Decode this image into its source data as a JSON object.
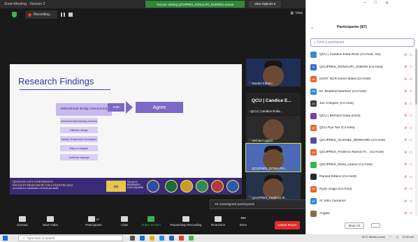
{
  "window": {
    "app_title": "Zoom Meeting - Session 2",
    "share_banner": "You are viewing QCUPRES_DONALPH_DUERN's screen",
    "view_options": "View Options ▾",
    "recording": "Recording...",
    "view": "View"
  },
  "slide": {
    "title": "Research Findings",
    "instructional_box": "Instructional design (resources)",
    "mean_value": "3.50",
    "result": "Agree",
    "sub_items": [
      "Interactive/self-learning modules",
      "Effective design",
      "Variety of instruction techniques",
      "Easy to navigate",
      "Audit/use displays"
    ],
    "footer_line1": "QUEZON CITY UNIVERSITY",
    "footer_line2": "FACULTY RESEARCH COLLOQUIUM 2022",
    "footer_line3": "AN ANNUAL GATHERING OF RESEARCHERS",
    "footer_mid": "4th",
    "footer_mid2": "FACULTY RESEARCH COLLOQUIUM"
  },
  "video_tiles": [
    {
      "name": "Randol Edtaco"
    },
    {
      "name": "QCU | Candice E..."
    },
    {
      "name": "Michael Ligayo"
    },
    {
      "name": "QCUPRES_DONALPH..."
    },
    {
      "name": "QCUPRES_Federico R..."
    }
  ],
  "text_tile": {
    "big": "QCU | Candice E...",
    "small": "QCU | Candice Erika..."
  },
  "toast": "19 unassigned participants",
  "toolbar": {
    "unmute": "Unmute",
    "start_video": "Start Video",
    "participants": "Participants",
    "participants_count": "87",
    "chat": "Chat",
    "share_screen": "Share Screen",
    "pause_recording": "Pause/Stop Recording",
    "reactions": "Reactions",
    "more": "More",
    "leave": "Leave Room"
  },
  "panel": {
    "title": "Participants (87)",
    "search_placeholder": "Find a participant",
    "participants": [
      {
        "initials": "",
        "name": "QCU | Candice Erika Reck (Co-host, me)",
        "color": "#3a8ad6"
      },
      {
        "initials": "Q",
        "name": "QCUPRES_DONALPH_DUERN (Co-host)",
        "color": "#2f6fcf"
      },
      {
        "initials": "DR",
        "name": "DOST NCR Karen Malal (Co-host)",
        "color": "#e06a2a"
      },
      {
        "initials": "DB",
        "name": "Dr. Bradford Martinez (Co-host)",
        "color": "#2e8ad8"
      },
      {
        "initials": "JA",
        "name": "Jun Antiquez (Co-host)",
        "color": "#3b3b3b"
      },
      {
        "initials": "",
        "name": "QCU | Bernard Gioia (Host)",
        "color": "#7a3fa8"
      },
      {
        "initials": "QP",
        "name": "QCU Pya Tan (Co-host)",
        "color": "#e06a2a"
      },
      {
        "initials": "",
        "name": "QCUPRES_ISAENEL_BERNARD (Co-host)",
        "color": "#5a4a9a"
      },
      {
        "initials": "QE",
        "name": "QCUPRES_Federico Ramon R... (Co-host)",
        "color": "#e0662a"
      },
      {
        "initials": "",
        "name": "QCUPRES_Rhea_Lilanio (Co-host)",
        "color": "#3bb54a"
      },
      {
        "initials": "",
        "name": "Randol Edtaco (Co-host)",
        "color": "#2a2a2a"
      },
      {
        "initials": "RA",
        "name": "Ryan Arago (Co-host)",
        "color": "#e0662a"
      },
      {
        "initials": "AC",
        "name": "Al John Camancn",
        "color": "#2e8ad8"
      },
      {
        "initials": "",
        "name": "Angele",
        "color": "#8a6a4a"
      }
    ],
    "mute_all": "Mute All",
    "more": "..."
  },
  "taskbar": {
    "search": "Type here to search",
    "weather": "32°C  Mostly sunny",
    "time": "11:00 am"
  }
}
